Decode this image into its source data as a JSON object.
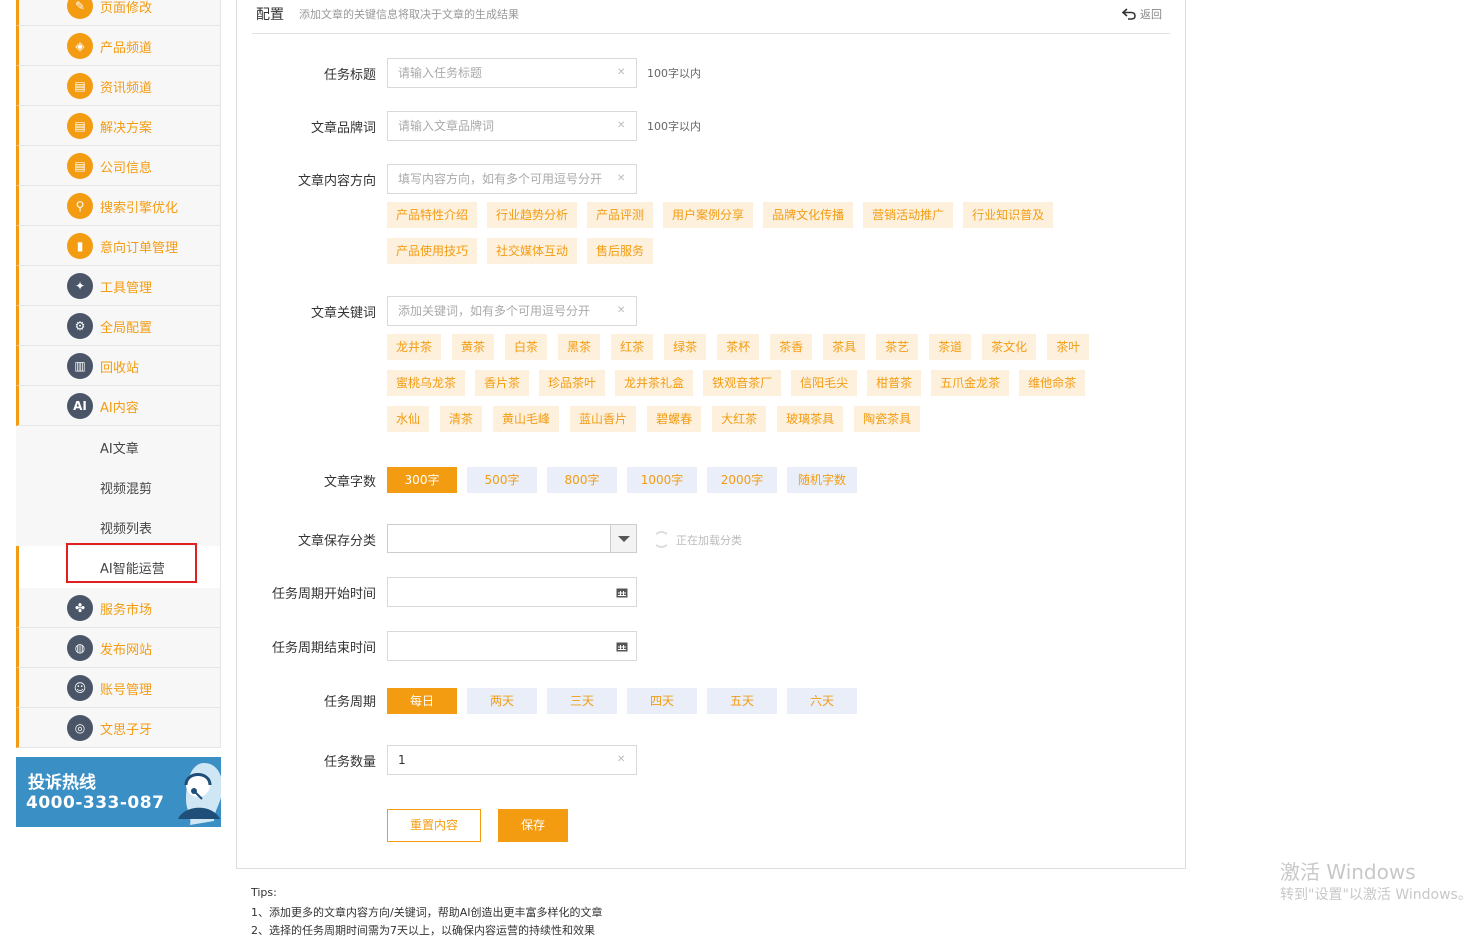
{
  "sidebar": {
    "items": [
      {
        "label": "页面修改",
        "icon": "edit-icon",
        "color": "#f39c12"
      },
      {
        "label": "产品频道",
        "icon": "box-icon",
        "color": "#f39c12"
      },
      {
        "label": "资讯频道",
        "icon": "news-icon",
        "color": "#f39c12"
      },
      {
        "label": "解决方案",
        "icon": "solution-icon",
        "color": "#f39c12"
      },
      {
        "label": "公司信息",
        "icon": "company-icon",
        "color": "#f39c12"
      },
      {
        "label": "搜索引擎优化",
        "icon": "search-icon",
        "color": "#f39c12"
      },
      {
        "label": "意向订单管理",
        "icon": "order-icon",
        "color": "#f39c12"
      },
      {
        "label": "工具管理",
        "icon": "wrench-icon",
        "color": "#4a5568"
      },
      {
        "label": "全局配置",
        "icon": "gear-icon",
        "color": "#4a5568"
      },
      {
        "label": "回收站",
        "icon": "trash-icon",
        "color": "#4a5568"
      },
      {
        "label": "AI内容",
        "icon": "ai-icon",
        "color": "#4a5568"
      }
    ],
    "ai_sub": [
      "AI文章",
      "视频混剪",
      "视频列表",
      "AI智能运营"
    ],
    "items_after": [
      {
        "label": "服务市场",
        "icon": "apps-icon",
        "color": "#4a5568"
      },
      {
        "label": "发布网站",
        "icon": "globe-icon",
        "color": "#4a5568"
      },
      {
        "label": "账号管理",
        "icon": "user-icon",
        "color": "#4a5568"
      },
      {
        "label": "文思子牙",
        "icon": "logo-icon",
        "color": "#4a5568"
      }
    ],
    "hotline": {
      "title": "投诉热线",
      "number": "4000-333-087"
    }
  },
  "header": {
    "title": "配置",
    "desc": "添加文章的关键信息将取决于文章的生成结果",
    "back": "返回"
  },
  "form": {
    "task_title": {
      "label": "任务标题",
      "placeholder": "请输入任务标题",
      "hint": "100字以内"
    },
    "brand": {
      "label": "文章品牌词",
      "placeholder": "请输入文章品牌词",
      "hint": "100字以内"
    },
    "direction": {
      "label": "文章内容方向",
      "placeholder": "填写内容方向，如有多个可用逗号分开",
      "chips": [
        "产品特性介绍",
        "行业趋势分析",
        "产品评测",
        "用户案例分享",
        "品牌文化传播",
        "营销活动推广",
        "行业知识普及",
        "产品使用技巧",
        "社交媒体互动",
        "售后服务"
      ]
    },
    "keywords": {
      "label": "文章关键词",
      "placeholder": "添加关键词，如有多个可用逗号分开",
      "chips": [
        "龙井茶",
        "黄茶",
        "白茶",
        "黑茶",
        "红茶",
        "绿茶",
        "茶杯",
        "茶香",
        "茶具",
        "茶艺",
        "茶道",
        "茶文化",
        "茶叶",
        "蜜桃乌龙茶",
        "香片茶",
        "珍品茶叶",
        "龙井茶礼盒",
        "铁观音茶厂",
        "信阳毛尖",
        "柑普茶",
        "五爪金龙茶",
        "维他命茶",
        "水仙",
        "清茶",
        "黄山毛峰",
        "蓝山香片",
        "碧螺春",
        "大红茶",
        "玻璃茶具",
        "陶瓷茶具"
      ]
    },
    "word_count": {
      "label": "文章字数",
      "options": [
        "300字",
        "500字",
        "800字",
        "1000字",
        "2000字",
        "随机字数"
      ],
      "selected": "300字"
    },
    "category": {
      "label": "文章保存分类",
      "loading": "正在加载分类"
    },
    "start": {
      "label": "任务周期开始时间"
    },
    "end": {
      "label": "任务周期结束时间"
    },
    "period": {
      "label": "任务周期",
      "options": [
        "每日",
        "两天",
        "三天",
        "四天",
        "五天",
        "六天"
      ],
      "selected": "每日"
    },
    "quantity": {
      "label": "任务数量",
      "value": "1"
    },
    "reset": "重置内容",
    "save": "保存"
  },
  "tips": [
    "Tips:",
    "1、添加更多的文章内容方向/关键词，帮助AI创造出更丰富多样化的文章",
    "2、选择的任务周期时间需为7天以上，以确保内容运营的持续性和效果"
  ],
  "watermark": {
    "line1": "激活 Windows",
    "line2": "转到\"设置\"以激活 Windows。"
  },
  "colors": {
    "accent": "#f39c12",
    "chip_bg": "#fdf0dc",
    "option_bg": "#e9eef8",
    "highlight": "#e02020"
  }
}
